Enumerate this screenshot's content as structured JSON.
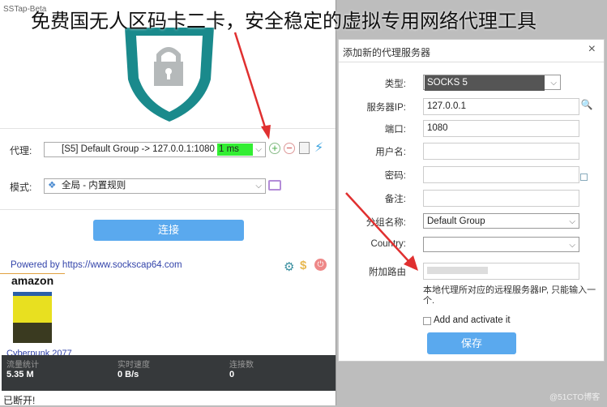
{
  "headline": "免费国无人区码卡二卡，安全稳定的虚拟专用网络代理工具",
  "app": {
    "title": "SSTap-Beta",
    "proxy_label": "代理:",
    "proxy_value": "[S5] Default Group -> 127.0.0.1:1080",
    "latency": "1 ms",
    "mode_label": "模式:",
    "mode_value": "全局 - 内置规则",
    "connect_label": "连接",
    "powered": "Powered by https://www.sockscap64.com",
    "ad_brand": "amazon",
    "ad_caption": "Cyberpunk 2077",
    "stats": [
      {
        "label": "流量统计",
        "value": "5.35 M"
      },
      {
        "label": "实时速度",
        "value": "0 B/s"
      },
      {
        "label": "连接数",
        "value": "0"
      }
    ],
    "status": "已断开!",
    "colors": {
      "latency_bg": "#33ee33",
      "connect_bg": "#5aa9ee",
      "stats_bg": "#36393b",
      "shield": "#1a8a8c"
    }
  },
  "dialog": {
    "title": "添加新的代理服务器",
    "close": "×",
    "fields": [
      {
        "label": "类型:",
        "value": "SOCKS 5",
        "type": "select"
      },
      {
        "label": "服务器IP:",
        "value": "127.0.0.1",
        "type": "input"
      },
      {
        "label": "端口:",
        "value": "1080",
        "type": "input"
      },
      {
        "label": "用户名:",
        "value": "",
        "type": "input"
      },
      {
        "label": "密码:",
        "value": "",
        "type": "input"
      },
      {
        "label": "备注:",
        "value": "",
        "type": "input"
      },
      {
        "label": "分组名称:",
        "value": "Default Group",
        "type": "select"
      },
      {
        "label": "Country:",
        "value": "",
        "type": "select"
      },
      {
        "label": "附加路由",
        "value": "",
        "type": "input"
      }
    ],
    "hint": "本地代理所对应的远程服务器IP, 只能输入一个.",
    "checkbox_label": "Add and activate it",
    "save_label": "保存"
  },
  "watermark": "@51CTO博客"
}
